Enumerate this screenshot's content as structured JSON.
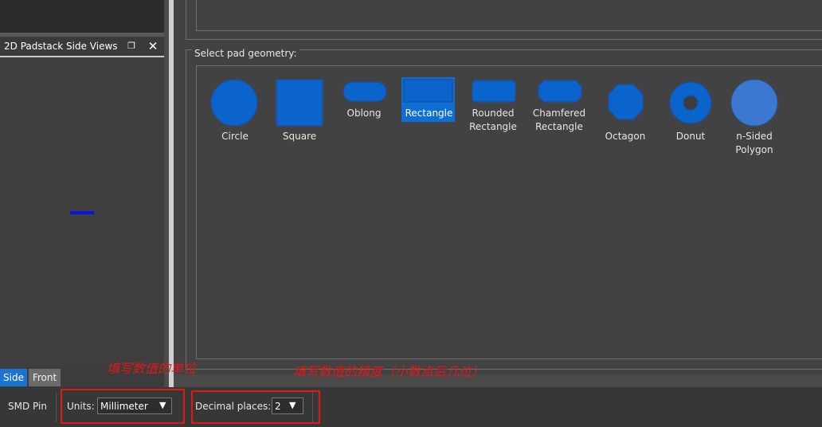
{
  "side_views_panel": {
    "title": "2D Padstack Side Views",
    "float_icon": "restore-window-icon",
    "close_icon": "close-icon",
    "tabs": [
      "Side",
      "Front"
    ]
  },
  "geometry": {
    "group_title": "Select pad geometry:",
    "accent_color": "#0a64cc",
    "selected": "Rectangle",
    "shapes": [
      {
        "name": "circle",
        "label": "Circle"
      },
      {
        "name": "square",
        "label": "Square"
      },
      {
        "name": "oblong",
        "label": "Oblong"
      },
      {
        "name": "rectangle",
        "label": "Rectangle"
      },
      {
        "name": "rounded-rectangle",
        "label": "Rounded\nRectangle"
      },
      {
        "name": "chamfered-rectangle",
        "label": "Chamfered\nRectangle"
      },
      {
        "name": "octagon",
        "label": "Octagon"
      },
      {
        "name": "donut",
        "label": "Donut"
      },
      {
        "name": "n-sided-polygon",
        "label": "n-Sided\nPolygon"
      }
    ]
  },
  "status_bar": {
    "mode": "SMD Pin",
    "units_label": "Units:",
    "units_value": "Millimeter",
    "decimal_label": "Decimal places:",
    "decimal_value": "2"
  },
  "annotations": {
    "units_note": "填写数值的单位",
    "decimal_note": "填写数值的精度（小数点后几位）",
    "color": "#e01818"
  }
}
